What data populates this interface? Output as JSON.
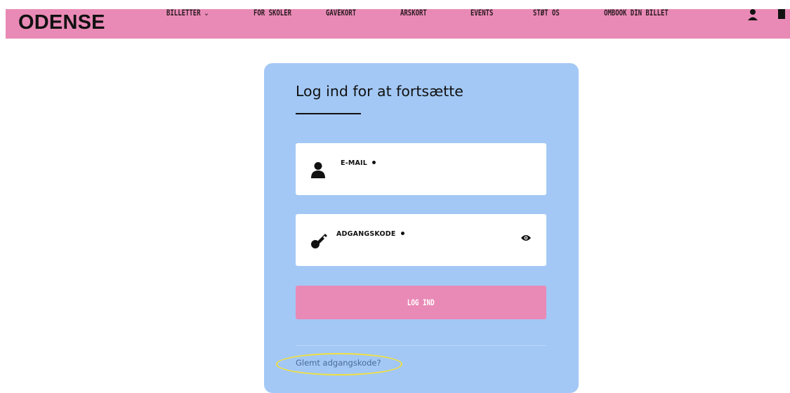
{
  "header": {
    "logo": "ODENSE",
    "nav": [
      {
        "label": "BILLETTER",
        "has_dropdown": true
      },
      {
        "label": "FOR SKOLER"
      },
      {
        "label": "GAVEKORT"
      },
      {
        "label": "ÅRSKORT"
      },
      {
        "label": "EVENTS"
      },
      {
        "label": "STØT OS"
      },
      {
        "label": "OMBOOK DIN BILLET"
      }
    ],
    "icons": [
      "user-icon",
      "bag-icon"
    ]
  },
  "login": {
    "title": "Log ind for at fortsætte",
    "email": {
      "label": "E-MAIL",
      "value": "",
      "icon": "user-icon"
    },
    "password": {
      "label": "ADGANGSKODE",
      "value": "",
      "icon": "key-icon",
      "toggle_icon": "eye-icon"
    },
    "submit_label": "LOG IND",
    "forgot_label": "Glemt adgangskode?"
  },
  "colors": {
    "header_bg": "#e98ab6",
    "card_bg": "#a3c8f5",
    "button_bg": "#e98ab6",
    "link": "#4a6a9c",
    "highlight": "#f1e040"
  }
}
